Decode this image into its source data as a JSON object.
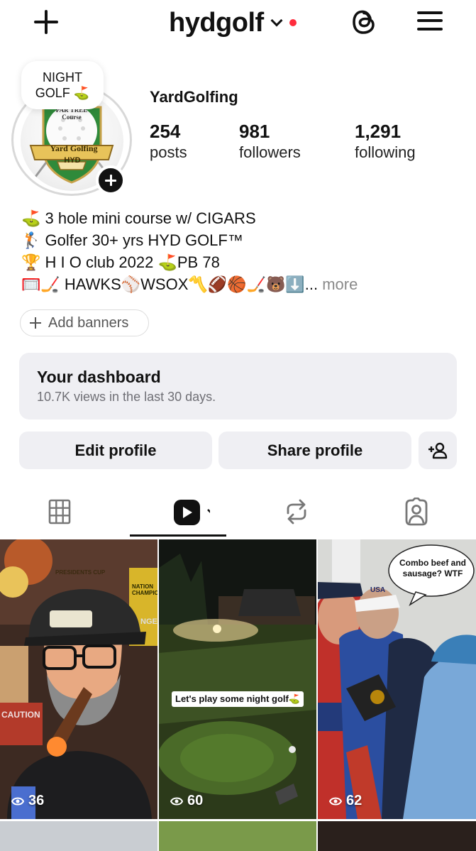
{
  "header": {
    "username": "hydgolf"
  },
  "profile": {
    "note_line1": "NIGHT",
    "note_line2": "GOLF ⛳️",
    "avatar_text_course": "PAR TREE Course",
    "avatar_text_banner": "Yard Golfing",
    "avatar_text_hyd": "HYD",
    "display_name": "YardGolfing",
    "stats": [
      {
        "value": "254",
        "label": "posts"
      },
      {
        "value": "981",
        "label": "followers"
      },
      {
        "value": "1,291",
        "label": "following"
      }
    ],
    "bio": [
      "⛳️ 3 hole mini course w/ CIGARS",
      "🏌️ Golfer 30+ yrs HYD GOLF™",
      "🏆 H I O club 2022 ⛳️PB 78",
      "🥅🏒 HAWKS⚾️WSOX〽️🏈🏀🏒🐻⬇️..."
    ],
    "bio_more": " more"
  },
  "banners": {
    "label": "Add banners"
  },
  "dashboard": {
    "title": "Your dashboard",
    "subtitle": "10.7K views in the last 30 days."
  },
  "actions": {
    "edit": "Edit profile",
    "share": "Share profile"
  },
  "grid": {
    "posts": [
      {
        "views": "36",
        "overlay": ""
      },
      {
        "views": "60",
        "overlay": "Let's play some night golf⛳️"
      },
      {
        "views": "62",
        "overlay": "Combo beef and sausage? WTF"
      }
    ],
    "sign_text_1": "PRESIDENTS CUP",
    "sign_text_2": "NATION CHAMPIO",
    "sign_text_3": "CAUTION",
    "sign_text_4": "NGE",
    "shirt_text": "USA"
  },
  "colors": {
    "accent_red": "#ff2d3d",
    "button_bg": "#efeff3"
  }
}
